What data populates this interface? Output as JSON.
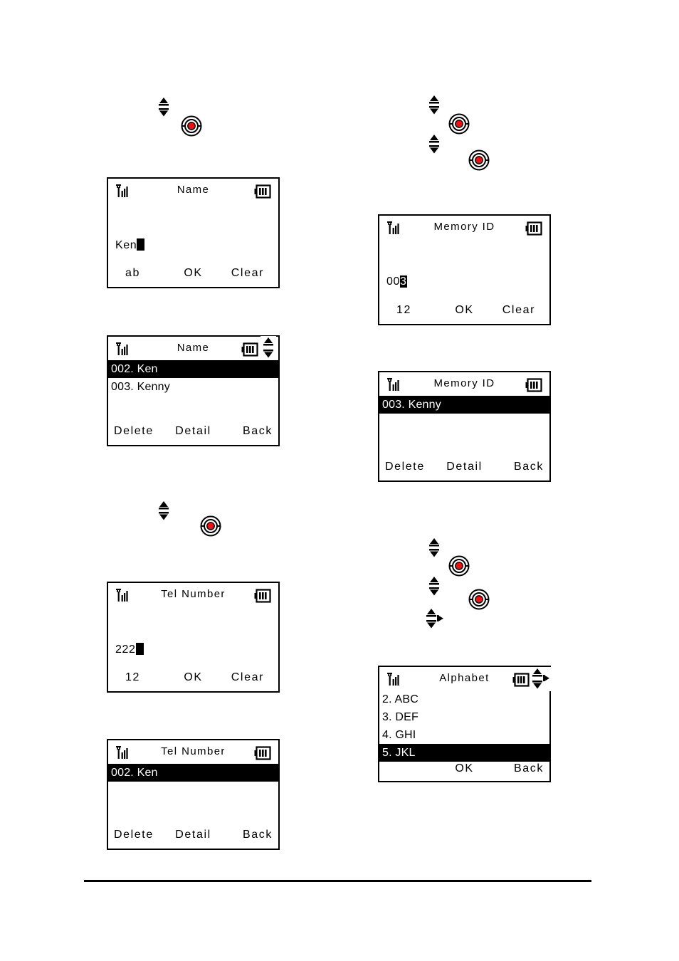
{
  "document": {
    "type": "mobile-phone-manual-page",
    "icons": {
      "antenna": "antenna-signal-icon",
      "battery": "battery-icon",
      "scroll_updown": "scroll-up-down-indicator",
      "scroll_updownright": "scroll-up-down-right-indicator",
      "nav_updown": "nav-up-down-key-icon",
      "nav_updownright": "nav-up-down-right-key-icon",
      "ok_key": "ok-center-key-icon"
    },
    "colors": {
      "ink": "#000000",
      "paper": "#ffffff",
      "key_center": "#ee1111"
    }
  },
  "screens": {
    "name_entry": {
      "title": "Name",
      "entry_text": "Ken",
      "softkeys": {
        "left": "ab",
        "center": "OK",
        "right": "Clear"
      }
    },
    "name_list": {
      "title": "Name",
      "rows": [
        {
          "label": "002. Ken",
          "selected": true
        },
        {
          "label": "003. Kenny",
          "selected": false
        }
      ],
      "softkeys": {
        "left": "Delete",
        "center": "Detail",
        "right": "Back"
      }
    },
    "tel_entry": {
      "title": "Tel Number",
      "entry_text": "222",
      "softkeys": {
        "left": "12",
        "center": "OK",
        "right": "Clear"
      }
    },
    "tel_list": {
      "title": "Tel Number",
      "rows": [
        {
          "label": "002. Ken",
          "selected": true
        }
      ],
      "softkeys": {
        "left": "Delete",
        "center": "Detail",
        "right": "Back"
      }
    },
    "memory_id_entry": {
      "title": "Memory ID",
      "entry_prefix": "00",
      "entry_cursor_char": "3",
      "softkeys": {
        "left": "12",
        "center": "OK",
        "right": "Clear"
      }
    },
    "memory_id_list": {
      "title": "Memory ID",
      "rows": [
        {
          "label": "003. Kenny",
          "selected": true
        }
      ],
      "softkeys": {
        "left": "Delete",
        "center": "Detail",
        "right": "Back"
      }
    },
    "alphabet": {
      "title": "Alphabet",
      "rows": [
        {
          "label": "2. ABC",
          "selected": false
        },
        {
          "label": "3. DEF",
          "selected": false
        },
        {
          "label": "4. GHI",
          "selected": false
        },
        {
          "label": "5. JKL",
          "selected": true
        }
      ],
      "softkeys": {
        "left": "",
        "center": "OK",
        "right": "Back"
      }
    }
  }
}
